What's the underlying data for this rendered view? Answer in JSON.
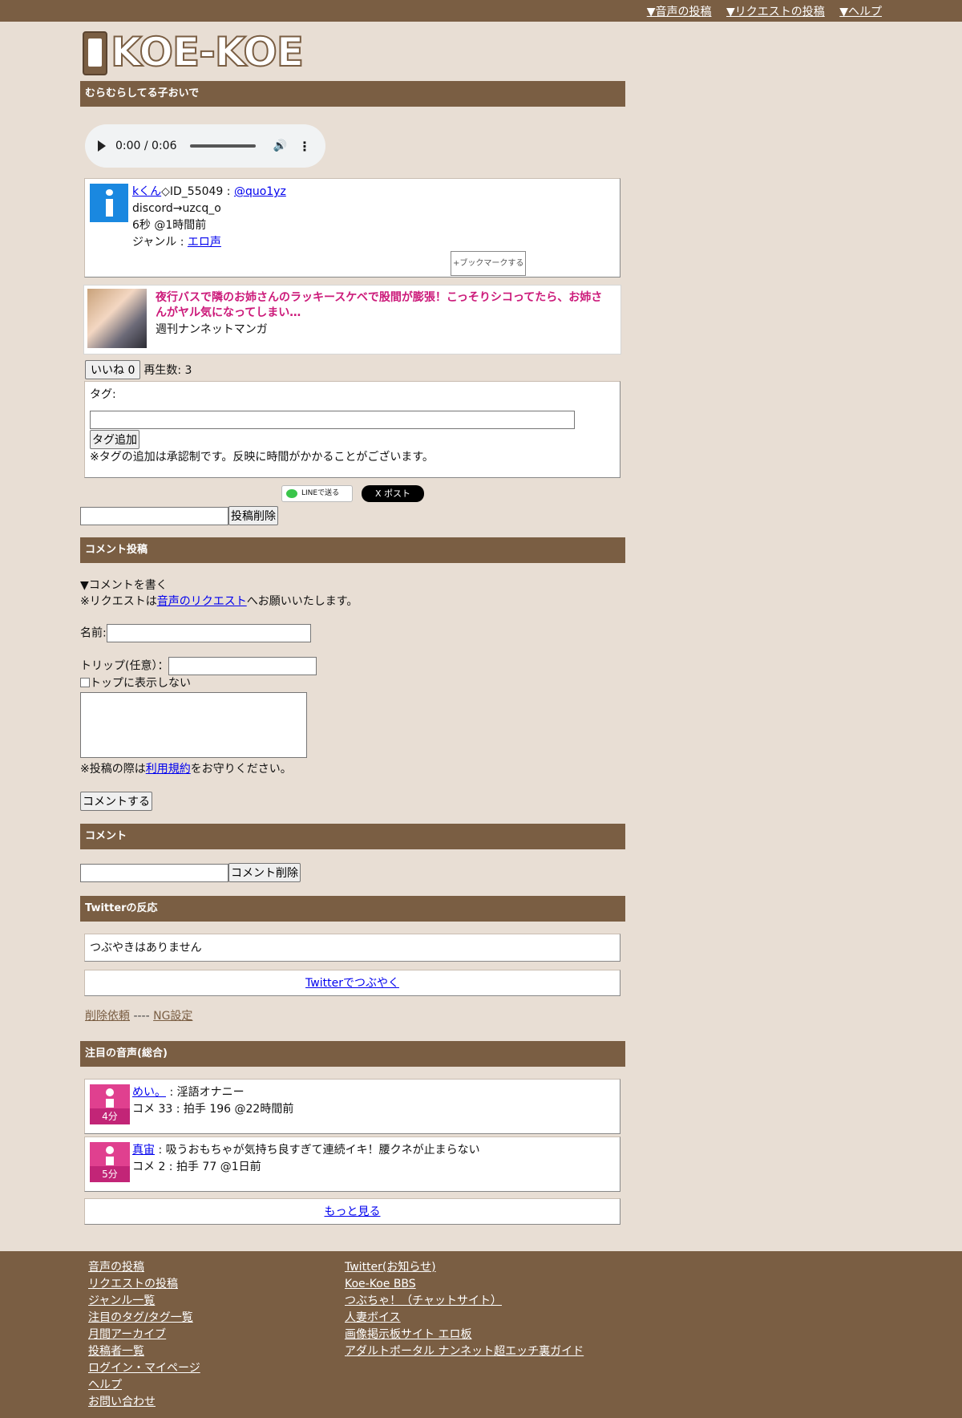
{
  "topnav": {
    "items": [
      "▼音声の投稿",
      "▼リクエストの投稿",
      "▼ヘルプ"
    ]
  },
  "logo": {
    "text": "KOE-KOE"
  },
  "post": {
    "title": "むらむらしてる子おいで",
    "audio": {
      "time": "0:00 / 0:06"
    },
    "author_name": "kくん",
    "author_id": "◇ID_55049 : ",
    "author_handle": "@quo1yz",
    "line2": "discord→uzcq_o",
    "line3": "6秒 @1時間前",
    "genre_label": "ジャンル : ",
    "genre": "エロ声",
    "bookmark": "+ブックマークする"
  },
  "ad": {
    "title": "夜行バスで隣のお姉さんのラッキースケベで股間が膨張！こっそりシコってたら、お姉さんがヤル気になってしまい…",
    "source": "週刊ナンネットマンガ"
  },
  "like": {
    "button": "いいね 0",
    "plays": "再生数: 3"
  },
  "tags": {
    "label": "タグ:",
    "add_button": "タグ追加",
    "note": "※タグの追加は承認制です。反映に時間がかかることがございます。"
  },
  "share": {
    "line": "LINEで送る",
    "x": "X ポスト"
  },
  "delete_post_button": "投稿削除",
  "comment_form": {
    "header": "コメント投稿",
    "write": "▼コメントを書く",
    "req_prefix": "※リクエストは",
    "req_link": "音声のリクエスト",
    "req_suffix": "へお願いいたします。",
    "name_label": "名前:",
    "trip_label": "トリップ(任意）：",
    "hide_top": "トップに表示しない",
    "terms_prefix": "※投稿の際は",
    "terms_link": "利用規約",
    "terms_suffix": "をお守りください。",
    "submit": "コメントする"
  },
  "comments": {
    "header": "コメント",
    "delete_button": "コメント削除"
  },
  "twitter": {
    "header": "Twitterの反応",
    "empty": "つぶやきはありません",
    "tweet_link": "Twitterでつぶやく",
    "delete_request": "削除依頼",
    "separator": " ---- ",
    "ng": "NG設定"
  },
  "featured": {
    "header": "注目の音声(総合)",
    "items": [
      {
        "author": "めい。",
        "title": " : 淫語オナニー",
        "stats": "コメ 33 : 拍手 196 @22時間前",
        "duration": "4分"
      },
      {
        "author": "真宙",
        "title": " : 吸うおもちゃが気持ち良すぎて連続イキ！腰クネが止まらない",
        "stats": "コメ 2 : 拍手 77 @1日前",
        "duration": "5分"
      }
    ],
    "more": "もっと見る"
  },
  "footer": {
    "col1": [
      "音声の投稿",
      "リクエストの投稿",
      "ジャンル一覧",
      "注目のタグ/タグ一覧",
      "月間アーカイブ",
      "投稿者一覧",
      "ログイン・マイページ",
      "ヘルプ",
      "お問い合わせ"
    ],
    "col2": [
      "Twitter(お知らせ)",
      "Koe-Koe BBS",
      "つぶちゃ！（チャットサイト）",
      "人妻ボイス",
      "画像掲示板サイト エロ板",
      "アダルトポータル ナンネット超エッチ裏ガイド"
    ]
  }
}
